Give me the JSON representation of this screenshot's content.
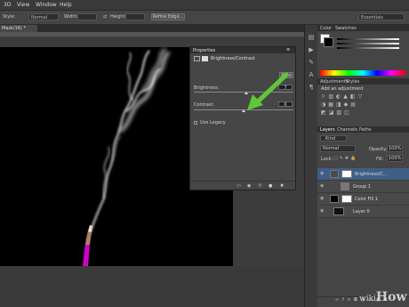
{
  "menubar": {
    "items": [
      "3D",
      "View",
      "Window",
      "Help"
    ]
  },
  "options": {
    "style_label": "Style:",
    "style_value": "Normal",
    "width_label": "Width:",
    "height_label": "Height:",
    "refine_button": "Refine Edge...",
    "workspace": "Essentials"
  },
  "document": {
    "tab_title": "Mask/16) *"
  },
  "properties": {
    "title": "Properties",
    "adjustment_name": "Brightness/Contrast",
    "auto_button": "Auto",
    "brightness_label": "Brightness:",
    "brightness_value": "7",
    "brightness_level": 0.53,
    "contrast_label": "Contrast:",
    "contrast_value": "0",
    "contrast_level": 0.5,
    "legacy_label": "Use Legacy"
  },
  "color_panel": {
    "tabs": [
      "Color",
      "Swatches"
    ]
  },
  "adjustments_panel": {
    "tabs": [
      "Adjustments",
      "Styles"
    ],
    "add_label": "Add an adjustment"
  },
  "layers_panel": {
    "tabs": [
      "Layers",
      "Channels",
      "Paths"
    ],
    "kind_label": "Kind",
    "blend_mode": "Normal",
    "opacity_label": "Opacity:",
    "opacity_value": "100%",
    "lock_label": "Lock:",
    "fill_label": "Fill:",
    "fill_value": "100%",
    "layers": [
      {
        "name": "Brightness/C...",
        "selected": true
      },
      {
        "name": "Group 1",
        "selected": false
      },
      {
        "name": "Color Fill 1",
        "selected": false
      },
      {
        "name": "Layer 0",
        "selected": false
      }
    ]
  },
  "watermark": {
    "brand": "wiki",
    "suffix": "How"
  },
  "colors": {
    "canvas": "#000000",
    "ui_dark": "#3c3c3c",
    "selected_layer": "#3f5e86",
    "arrow": "#5fc63a",
    "incense": "#d400c8"
  }
}
